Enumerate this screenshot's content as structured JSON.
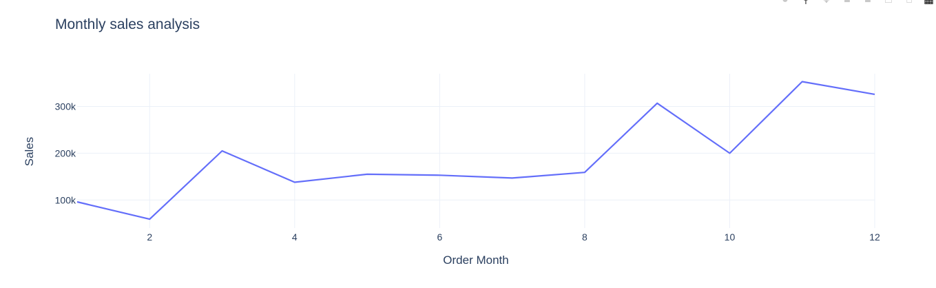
{
  "chart_data": {
    "type": "line",
    "title": "Monthly sales analysis",
    "xlabel": "Order Month",
    "ylabel": "Sales",
    "x": [
      1,
      2,
      3,
      4,
      5,
      6,
      7,
      8,
      9,
      10,
      11,
      12
    ],
    "series": [
      {
        "values": [
          96000,
          59000,
          205000,
          138000,
          155000,
          153000,
          147000,
          159000,
          307000,
          200000,
          353000,
          326000
        ],
        "color": "#636efa"
      }
    ],
    "xlim": [
      1,
      12
    ],
    "ylim": [
      40000,
      370000
    ],
    "xticks": [
      2,
      4,
      6,
      8,
      10,
      12
    ],
    "xtick_labels": [
      "2",
      "4",
      "6",
      "8",
      "10",
      "12"
    ],
    "yticks": [
      100000,
      200000,
      300000
    ],
    "ytick_labels": [
      "100k",
      "200k",
      "300k"
    ],
    "grid": true,
    "legend": "none"
  },
  "modebar": {
    "icons": [
      "camera-icon",
      "zoom-icon",
      "pan-icon",
      "zoom-in-icon",
      "zoom-out-icon",
      "autoscale-icon",
      "home-icon",
      "plotly-logo-icon"
    ]
  }
}
